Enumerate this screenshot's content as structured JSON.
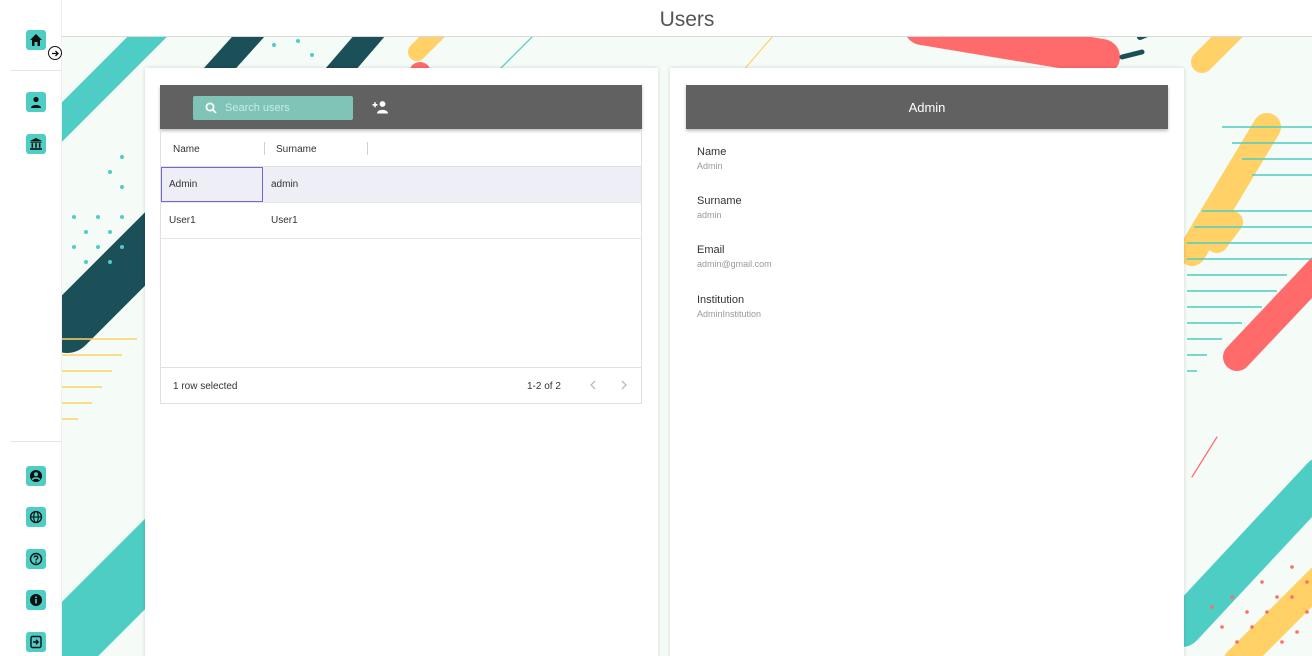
{
  "header": {
    "title": "Users"
  },
  "sidebar": {
    "top_items": [
      {
        "icon": "home-icon"
      },
      {
        "icon": "user-icon"
      },
      {
        "icon": "institution-icon"
      }
    ],
    "bottom_items": [
      {
        "icon": "account-circle-icon"
      },
      {
        "icon": "globe-icon"
      },
      {
        "icon": "help-icon"
      },
      {
        "icon": "info-icon"
      },
      {
        "icon": "logout-icon"
      }
    ]
  },
  "users_table": {
    "search_placeholder": "Search users",
    "columns": [
      "Name",
      "Surname"
    ],
    "rows": [
      {
        "name": "Admin",
        "surname": "admin",
        "selected": true
      },
      {
        "name": "User1",
        "surname": "User1",
        "selected": false
      }
    ],
    "footer": {
      "selected_text": "1 row selected",
      "pagination": "1-2 of 2"
    }
  },
  "details": {
    "title": "Admin",
    "fields": [
      {
        "label": "Name",
        "value": "Admin"
      },
      {
        "label": "Surname",
        "value": "admin"
      },
      {
        "label": "Email",
        "value": "admin@gmail.com"
      },
      {
        "label": "Institution",
        "value": "AdminInstitution"
      }
    ]
  },
  "colors": {
    "accent": "#4ecdc4",
    "toolbar": "#616161",
    "decor_teal": "#4ecdc4",
    "decor_dark": "#1b5058",
    "decor_yellow": "#ffd166",
    "decor_red": "#ff6b6b"
  }
}
